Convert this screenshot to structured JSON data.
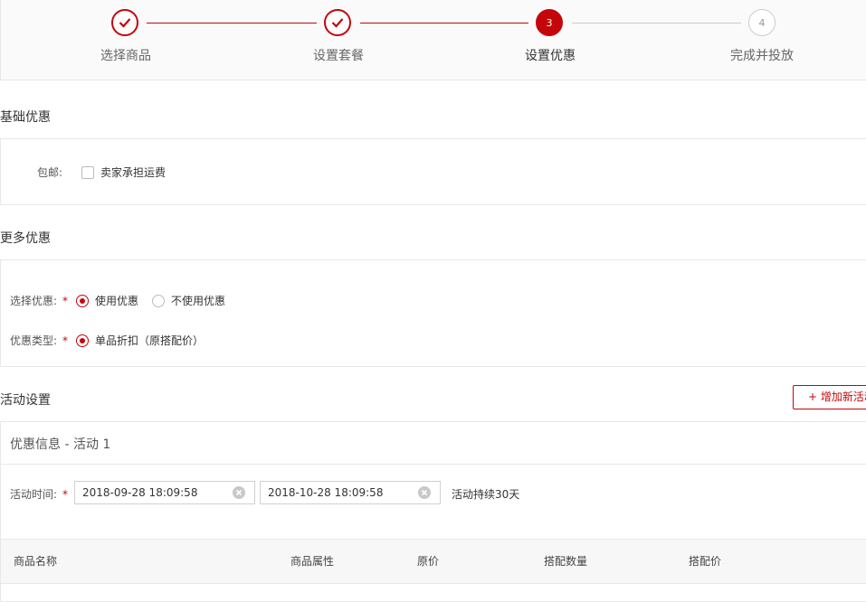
{
  "steps": [
    {
      "label": "选择商品",
      "state": "done",
      "number": ""
    },
    {
      "label": "设置套餐",
      "state": "done",
      "number": ""
    },
    {
      "label": "设置优惠",
      "state": "current",
      "number": "3"
    },
    {
      "label": "完成并投放",
      "state": "todo",
      "number": "4"
    }
  ],
  "basic": {
    "title": "基础优惠",
    "shipping_label": "包邮:",
    "shipping_option": "卖家承担运费"
  },
  "more": {
    "title": "更多优惠",
    "select_label": "选择优惠:",
    "use_option": "使用优惠",
    "no_use_option": "不使用优惠",
    "type_label": "优惠类型:",
    "type_option": "单品折扣（原搭配价）",
    "required_mark": "*"
  },
  "activity": {
    "title": "活动设置",
    "add_button": "+ 增加新活动",
    "panel_title": "优惠信息 - 活动 1",
    "time_label": "活动时间:",
    "start": "2018-09-28 18:09:58",
    "end": "2018-10-28 18:09:58",
    "duration": "活动持续30天"
  },
  "table": {
    "headers": [
      "商品名称",
      "商品属性",
      "原价",
      "搭配数量",
      "搭配价"
    ]
  },
  "colors": {
    "accent": "#c4060b"
  }
}
